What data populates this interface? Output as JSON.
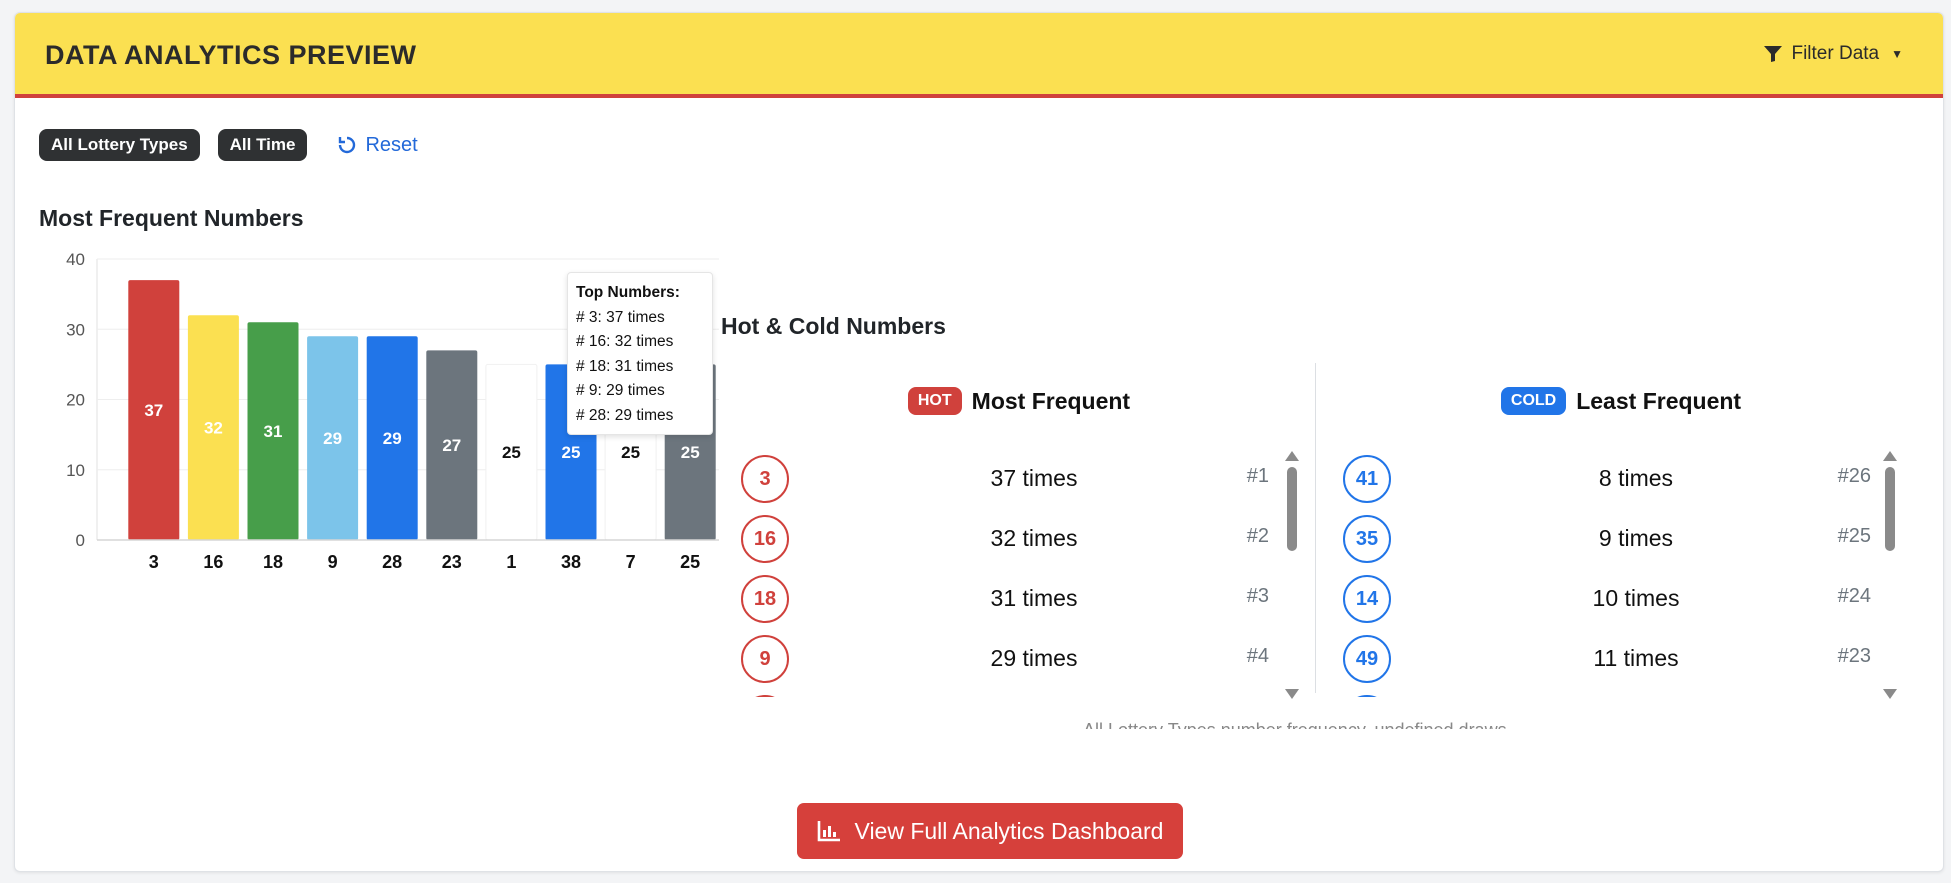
{
  "header": {
    "title": "DATA ANALYTICS PREVIEW",
    "filter_label": "Filter Data"
  },
  "filters": {
    "badges": [
      "All Lottery Types",
      "All Time"
    ],
    "reset_label": "Reset"
  },
  "most_frequent": {
    "title": "Most Frequent Numbers"
  },
  "chart_data": {
    "type": "bar",
    "title": "Most Frequent Numbers",
    "categories": [
      "3",
      "16",
      "18",
      "9",
      "28",
      "23",
      "1",
      "38",
      "7",
      "25"
    ],
    "values": [
      37,
      32,
      31,
      29,
      29,
      27,
      25,
      25,
      25,
      25
    ],
    "bar_colors": [
      "#d0413c",
      "#fbe051",
      "#479e4a",
      "#7cc4ea",
      "#2175e8",
      "#6c757d",
      "#ffffff",
      "#2175e8",
      "#ffffff",
      "#6c757d"
    ],
    "ylim": [
      0,
      40
    ],
    "yticks": [
      0,
      10,
      20,
      30,
      40
    ],
    "xlabel": "",
    "ylabel": ""
  },
  "tooltip": {
    "title": "Top Numbers:",
    "lines": [
      "# 3: 37 times",
      "# 16: 32 times",
      "# 18: 31 times",
      "# 9: 29 times",
      "# 28: 29 times"
    ]
  },
  "hot_cold": {
    "title": "Hot & Cold Numbers",
    "hot": {
      "badge": "HOT",
      "label": "Most Frequent",
      "items": [
        {
          "number": "3",
          "times": "37 times",
          "rank": "#1"
        },
        {
          "number": "16",
          "times": "32 times",
          "rank": "#2"
        },
        {
          "number": "18",
          "times": "31 times",
          "rank": "#3"
        },
        {
          "number": "9",
          "times": "29 times",
          "rank": "#4"
        }
      ]
    },
    "cold": {
      "badge": "COLD",
      "label": "Least Frequent",
      "items": [
        {
          "number": "41",
          "times": "8 times",
          "rank": "#26"
        },
        {
          "number": "35",
          "times": "9 times",
          "rank": "#25"
        },
        {
          "number": "14",
          "times": "10 times",
          "rank": "#24"
        },
        {
          "number": "49",
          "times": "11 times",
          "rank": "#23"
        }
      ]
    },
    "caption": "All Lottery Types number frequency, undefined draws"
  },
  "cta": {
    "label": "View Full Analytics Dashboard"
  },
  "colors": {
    "header_bg": "#fbe051",
    "accent_red": "#d0413c",
    "accent_blue": "#2175e8"
  }
}
